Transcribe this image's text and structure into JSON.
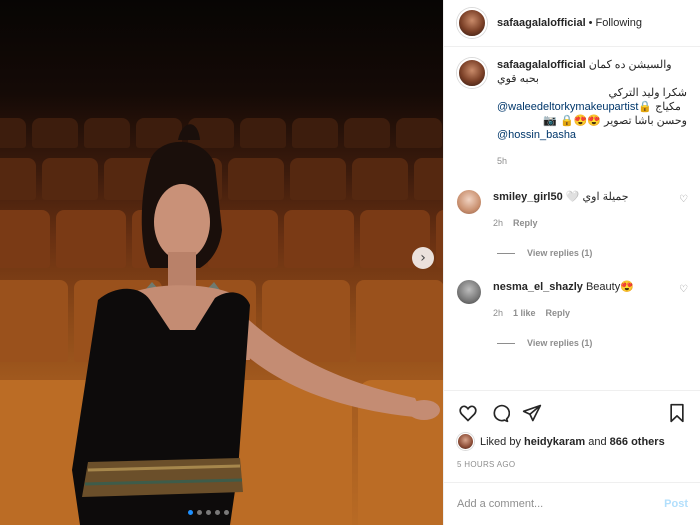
{
  "colors": {
    "link": "#00376b",
    "muted": "#8e8e8e",
    "post_disabled": "#b2dffc",
    "carousel_active": "#1e90ff"
  },
  "photo": {
    "next_icon": "chevron-right-icon",
    "next_glyph": "›",
    "slide_count": 5,
    "active_slide": 1
  },
  "post_header": {
    "username": "safaagalalofficial",
    "separator": "•",
    "follow_status": "Following"
  },
  "caption": {
    "username": "safaagalalofficial",
    "line1": "والسيشن ده كمان بحبه قوي",
    "line2": "شكرا وليد التركي",
    "mention1": "@waleedeltorkymakeupartist",
    "line3_suffix": " مكياج 🔒",
    "line4": "وحسن باشا تصوير 😍😍🔒 📷",
    "mention2": "@hossin_basha",
    "time": "5h"
  },
  "comments": [
    {
      "username": "smiley_girl50",
      "text": "جميلة اوي 🤍",
      "time": "2h",
      "likes": "",
      "reply_label": "Reply",
      "view_replies": "View replies (1)"
    },
    {
      "username": "nesma_el_shazly",
      "text": "Beauty😍",
      "time": "2h",
      "likes": "1 like",
      "reply_label": "Reply",
      "view_replies": "View replies (1)"
    }
  ],
  "actions": {
    "like_icon": "heart-icon",
    "comment_icon": "comment-icon",
    "share_icon": "share-icon",
    "save_icon": "bookmark-icon",
    "liked_by_prefix": "Liked by ",
    "liked_by_user": "heidykaram",
    "liked_by_middle": " and ",
    "liked_by_count": "866 others",
    "time_ago": "5 HOURS AGO"
  },
  "add_comment": {
    "placeholder": "Add a comment...",
    "post_label": "Post"
  }
}
